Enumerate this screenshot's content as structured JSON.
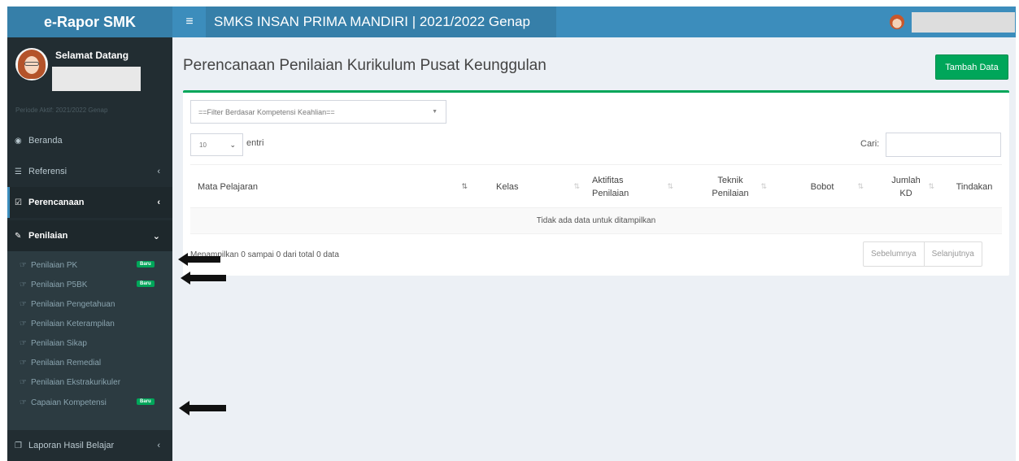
{
  "app": {
    "name": "e-Rapor SMK"
  },
  "header": {
    "menu_icon": "hamburger-icon",
    "school_title": "SMKS INSAN PRIMA MANDIRI | 2021/2022 Genap"
  },
  "sidebar": {
    "welcome": "Selamat Datang",
    "period": "Periode Aktif: 2021/2022 Genap",
    "items": [
      {
        "label": "Beranda",
        "icon": "dashboard-icon"
      },
      {
        "label": "Referensi",
        "icon": "list-icon"
      },
      {
        "label": "Perencanaan",
        "icon": "checkbox-icon"
      },
      {
        "label": "Penilaian",
        "icon": "edit-icon"
      },
      {
        "label": "Laporan Hasil Belajar",
        "icon": "copy-icon"
      }
    ],
    "submenu": [
      {
        "label": "Penilaian PK",
        "badge": "Baru"
      },
      {
        "label": "Penilaian P5BK",
        "badge": "Baru"
      },
      {
        "label": "Penilaian Pengetahuan"
      },
      {
        "label": "Penilaian Keterampilan"
      },
      {
        "label": "Penilaian Sikap"
      },
      {
        "label": "Penilaian Remedial"
      },
      {
        "label": "Penilaian Ekstrakurikuler"
      },
      {
        "label": "Capaian Kompetensi",
        "badge": "Baru"
      }
    ]
  },
  "main": {
    "page_title": "Perencanaan Penilaian Kurikulum Pusat Keunggulan",
    "add_button": "Tambah Data",
    "filter_placeholder": "==Filter Berdasar Kompetensi Keahlian==",
    "length_value": "10",
    "length_suffix": "entri",
    "search_label": "Cari:",
    "columns": [
      {
        "line1": "Mata Pelajaran",
        "line2": ""
      },
      {
        "line1": "Kelas",
        "line2": ""
      },
      {
        "line1": "Aktifitas",
        "line2": "Penilaian"
      },
      {
        "line1": "Teknik",
        "line2": "Penilaian"
      },
      {
        "line1": "Bobot",
        "line2": ""
      },
      {
        "line1": "Jumlah",
        "line2": "KD"
      },
      {
        "line1": "Tindakan",
        "line2": ""
      }
    ],
    "empty_message": "Tidak ada data untuk ditampilkan",
    "info": "Menampilkan 0 sampai 0 dari total 0 data",
    "prev": "Sebelumnya",
    "next": "Selanjutnya"
  },
  "colors": {
    "header": "#3c8dbc",
    "header_dark": "#367fa9",
    "sidebar": "#222d32",
    "success": "#00a65a"
  }
}
